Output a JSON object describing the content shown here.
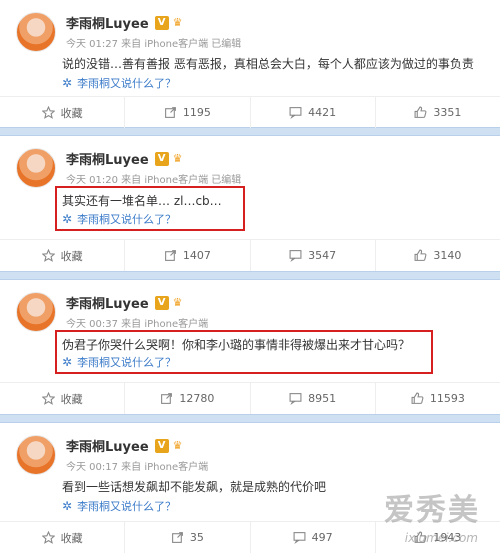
{
  "posts": [
    {
      "username": "李雨桐Luyee",
      "meta": "今天 01:27 来自 iPhone客户端  已编辑",
      "text": "说的没错…善有善报 恶有恶报，真相总会大白，每个人都应该为做过的事负责",
      "topic": "李雨桐又说什么了？",
      "actions": {
        "collect": "收藏",
        "repost": "1195",
        "comment": "4421",
        "like": "3351"
      }
    },
    {
      "username": "李雨桐Luyee",
      "meta": "今天 01:20 来自 iPhone客户端  已编辑",
      "text": "其实还有一堆名单… zl…cb…",
      "topic": "李雨桐又说什么了？",
      "actions": {
        "collect": "收藏",
        "repost": "1407",
        "comment": "3547",
        "like": "3140"
      }
    },
    {
      "username": "李雨桐Luyee",
      "meta": "今天 00:37 来自 iPhone客户端",
      "text": "伪君子你哭什么哭啊！你和李小璐的事情非得被爆出来才甘心吗？",
      "topic": "李雨桐又说什么了？",
      "actions": {
        "collect": "收藏",
        "repost": "12780",
        "comment": "8951",
        "like": "11593"
      }
    },
    {
      "username": "李雨桐Luyee",
      "meta": "今天 00:17 来自 iPhone客户端",
      "text": "看到一些话想发飙却不能发飙，就是成熟的代价吧",
      "topic": "李雨桐又说什么了？",
      "actions": {
        "collect": "收藏",
        "repost": "35",
        "comment": "497",
        "like": "1943"
      }
    }
  ],
  "watermark": {
    "main": "爱秀美",
    "sub": "ixiumei.com"
  },
  "colors": {
    "separator": "#cfe0f2",
    "link": "#3d7cc9",
    "highlight": "#d62020",
    "vip": "#e8a51c"
  },
  "icons": {
    "verified": "V-badge",
    "crown": "crown-icon",
    "collect": "star-icon",
    "repost": "repost-icon",
    "comment": "comment-icon",
    "like": "thumbs-up-icon",
    "topic": "sparkle-icon"
  }
}
